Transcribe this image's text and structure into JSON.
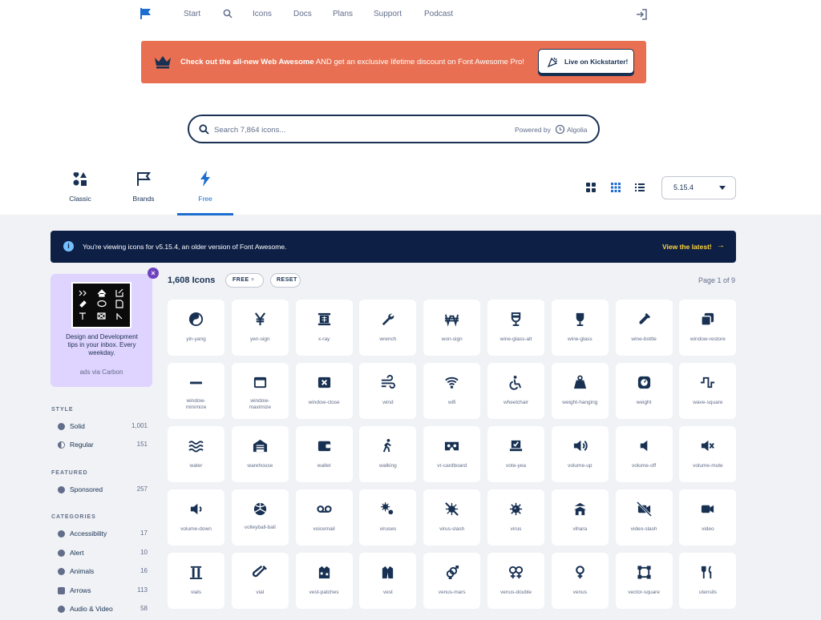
{
  "nav": {
    "links": [
      "Start",
      "Icons",
      "Docs",
      "Plans",
      "Support",
      "Podcast"
    ]
  },
  "banner": {
    "bold_text": "Check out the all-new Web Awesome",
    "rest_text": " AND get an exclusive lifetime discount on Font Awesome Pro!",
    "button_label": "Live on Kickstarter!",
    "color": "#e86f51"
  },
  "search": {
    "placeholder": "Search 7,864 icons...",
    "powered_by": "Powered by",
    "provider": "Algolia"
  },
  "tabs": [
    {
      "label": "Classic",
      "icon": "shapes-icon",
      "active": false
    },
    {
      "label": "Brands",
      "icon": "flag-icon",
      "active": false
    },
    {
      "label": "Free",
      "icon": "bolt-icon",
      "active": true
    }
  ],
  "version": {
    "selected": "5.15.4"
  },
  "notice": {
    "text": "You're viewing icons for v5.15.4, an older version of Font Awesome.",
    "link": "View the latest!"
  },
  "ad": {
    "text": "Design and Development tips in your inbox. Every weekday.",
    "via": "ads via Carbon"
  },
  "sidebar": {
    "style_heading": "STYLE",
    "styles": [
      {
        "label": "Solid",
        "count": "1,001"
      },
      {
        "label": "Regular",
        "count": "151"
      }
    ],
    "featured_heading": "FEATURED",
    "featured": [
      {
        "label": "Sponsored",
        "count": "257"
      }
    ],
    "categories_heading": "CATEGORIES",
    "categories": [
      {
        "label": "Accessibility",
        "count": "17"
      },
      {
        "label": "Alert",
        "count": "10"
      },
      {
        "label": "Animals",
        "count": "16"
      },
      {
        "label": "Arrows",
        "count": "113"
      },
      {
        "label": "Audio & Video",
        "count": "58"
      }
    ]
  },
  "results": {
    "count": "1,608 Icons",
    "filter_free": "FREE",
    "filter_free_x": "×",
    "reset": "RESET",
    "page": "Page 1 of 9"
  },
  "icons": [
    "yin-yang",
    "yen-sign",
    "x-ray",
    "wrench",
    "won-sign",
    "wine-glass-alt",
    "wine-glass",
    "wine-bottle",
    "window-restore",
    "window-minimize",
    "window-maximize",
    "window-close",
    "wind",
    "wifi",
    "wheelchair",
    "weight-hanging",
    "weight",
    "wave-square",
    "water",
    "warehouse",
    "wallet",
    "walking",
    "vr-cardboard",
    "vote-yea",
    "volume-up",
    "volume-off",
    "volume-mute",
    "volume-down",
    "volleyball-ball",
    "voicemail",
    "viruses",
    "virus-slash",
    "virus",
    "vihara",
    "video-slash",
    "video",
    "vials",
    "vial",
    "vest-patches",
    "vest",
    "venus-mars",
    "venus-double",
    "venus",
    "vector-square",
    "utensils"
  ]
}
